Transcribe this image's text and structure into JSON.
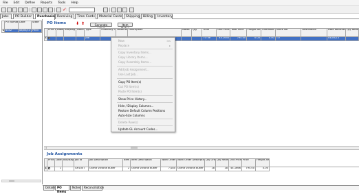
{
  "menu": [
    "File",
    "Edit",
    "Define",
    "Reports",
    "Tools",
    "Help"
  ],
  "tabs": [
    "Jobs",
    "PO Builder",
    "Purchasing",
    "Receiving",
    "Time Cards",
    "Material Cards",
    "Shipping",
    "Billing",
    "Inventory"
  ],
  "left_grid": {
    "headers": [
      "PO Number",
      "Date",
      "State"
    ],
    "row": [
      "6342",
      "08/05/13",
      "Pend"
    ]
  },
  "po_items": {
    "title": "PO Items",
    "generate_label_btn": "Generate Label",
    "item_notes_btn": "Item Notes",
    "headers": [
      "Print Label",
      "Label Qty",
      "Box/Bag Contains",
      "Label Series",
      "Type",
      "Inventory Code",
      "Material Code",
      "Description",
      "Notes",
      "Qty",
      "UOM",
      "Unit Price",
      "Total Price",
      "Freight Amt",
      "Overhead Markup %",
      "Stock No.",
      "Destination",
      "Date Received",
      "Qty Received"
    ],
    "row": {
      "type": "Job",
      "qty": "",
      "uom": "TO ne",
      "unit_price": "44.2650",
      "total_price": "795.00",
      "freight": "0.00",
      "overhead": "0.00",
      "stock": "TO",
      "date_received": "04/05/13"
    }
  },
  "context_menu": [
    {
      "label": "New",
      "shortcut": "Ins",
      "disabled": true
    },
    {
      "label": "Replace",
      "disabled": true,
      "arrow": "▸"
    },
    {
      "label": "Copy Inventory Items...",
      "disabled": true
    },
    {
      "label": "Copy Library Items...",
      "disabled": true
    },
    {
      "label": "Copy Assembly Items...",
      "disabled": true
    },
    {
      "label": "Add Job Assignment...",
      "disabled": true
    },
    {
      "label": "Use Last Job...",
      "disabled": true
    },
    {
      "label": "Copy PO Item(s)",
      "disabled": false
    },
    {
      "label": "Cut PO Item(s)",
      "disabled": true
    },
    {
      "label": "Paste PO Item(s)",
      "disabled": true
    },
    {
      "label": "Show Price History...",
      "disabled": false
    },
    {
      "label": "Hide / Display Columns...",
      "disabled": false
    },
    {
      "label": "Restore Default Column Positions",
      "disabled": false
    },
    {
      "label": "Auto-Size Columns",
      "disabled": false
    },
    {
      "label": "Delete Row(s)",
      "disabled": true
    },
    {
      "label": "Update GL Account Codes...",
      "disabled": false
    }
  ],
  "job_assignments": {
    "title": "Job Assignments",
    "headers": [
      "Print Label",
      "Label Qty",
      "Box/Bag Contains",
      "Job Id",
      "Job Description",
      "Item No.",
      "Item Description",
      "Work Order",
      "Work Order Description",
      "Qty Ordered",
      "Qty Received",
      "Unit Price",
      "Price",
      "Freight Amt"
    ],
    "row": [
      "",
      "1",
      "",
      "GH1007",
      "Grand Victoria Butler",
      "2",
      "Grand Victoria Butler",
      "7/180",
      "Grand Victoria Butler",
      "18",
      "18",
      "44.1666",
      "795.00",
      "0.00"
    ]
  },
  "bottom_tabs": [
    "Details",
    "PO Items",
    "Notes",
    "Reconciliation"
  ]
}
